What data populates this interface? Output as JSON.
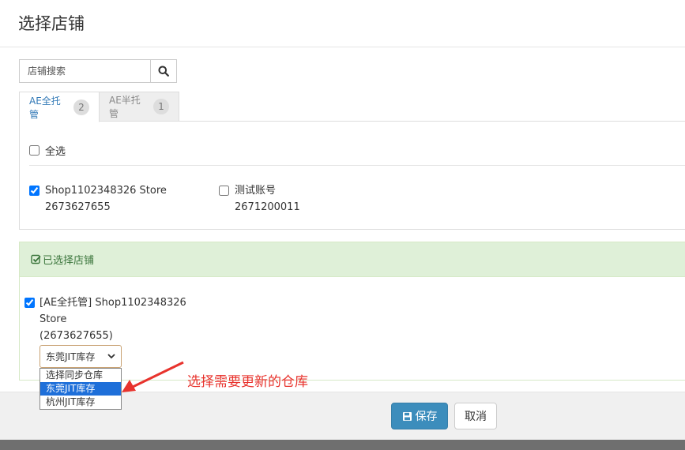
{
  "modal": {
    "title": "选择店铺"
  },
  "search": {
    "placeholder": "店铺搜索",
    "icon": "search-icon"
  },
  "tabs": [
    {
      "label": "AE全托管",
      "count": "2",
      "active": true
    },
    {
      "label": "AE半托管",
      "count": "1",
      "active": false
    }
  ],
  "select_all": {
    "label": "全选",
    "checked": false
  },
  "shops": [
    {
      "name": "Shop1102348326 Store",
      "id": "2673627655",
      "checked": true
    },
    {
      "name": "测试账号",
      "id": "2671200011",
      "checked": false
    }
  ],
  "selected": {
    "heading": "已选择店铺",
    "items": [
      {
        "line1": "[AE全托管] Shop1102348326",
        "line2": "Store",
        "line3": "(2673627655)",
        "checked": true,
        "warehouse": "东莞JIT库存"
      }
    ]
  },
  "warehouse_options": [
    "选择同步仓库",
    "东莞JIT库存",
    "杭州JIT库存"
  ],
  "annotation": "选择需要更新的仓库",
  "footer": {
    "save": "保存",
    "cancel": "取消"
  },
  "colors": {
    "primary": "#3c8dbc",
    "tab_active": "#337ab7",
    "success_bg": "#dff0d8",
    "success_text": "#3c763d",
    "annotation": "#e8332d",
    "option_highlight": "#1e6fd9"
  }
}
